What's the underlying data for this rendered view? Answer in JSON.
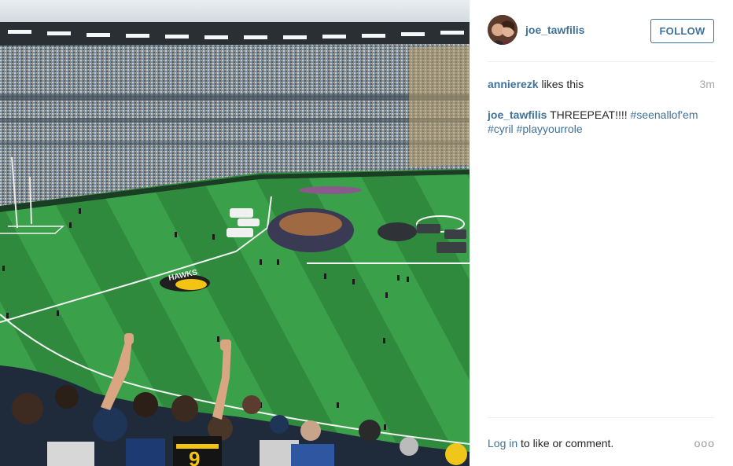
{
  "post": {
    "username": "joe_tawfilis",
    "follow_label": "FOLLOW",
    "likes": {
      "liker": "annierezk",
      "suffix": " likes this",
      "time": "3m"
    },
    "caption": {
      "author": "joe_tawfilis",
      "text": " THREEPEAT!!!! ",
      "tag_1": "#seenallof'em",
      "tag_2": "#cyril",
      "tag_3": "#playyourrole"
    },
    "comment": {
      "login_label": "Log in",
      "suffix": " to like or comment.",
      "more_label": "ooo"
    }
  },
  "photo": {
    "ground_sign": "HAWKS",
    "player_number": "9"
  },
  "colors": {
    "link": "#3f729b",
    "text": "#262626",
    "muted": "#a5a7aa",
    "divider": "#efefef",
    "grass_light": "#3aa04a",
    "grass_dark": "#2f8a3e"
  }
}
